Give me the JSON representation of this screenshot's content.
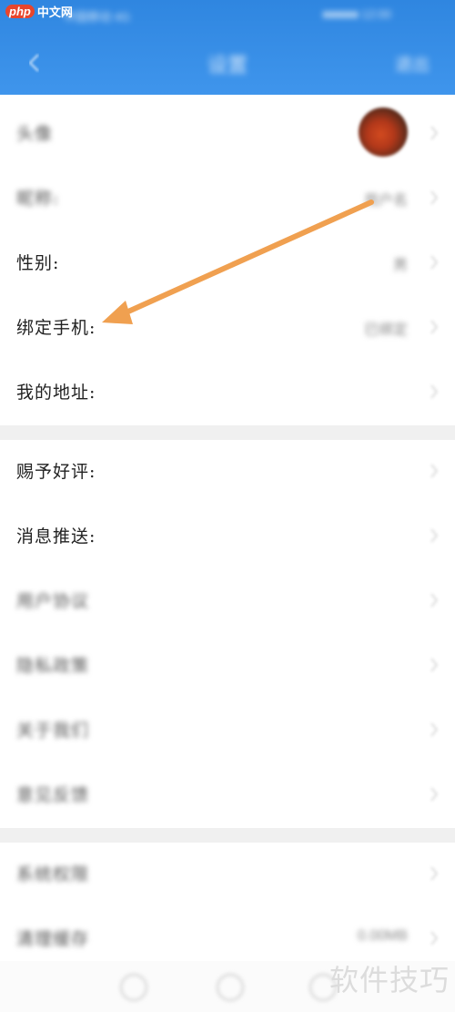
{
  "watermark": {
    "brand_prefix": "php",
    "brand_name": "中文网",
    "corner_text": "软件技巧"
  },
  "status_bar": {
    "left_text": "中国移动 4G",
    "right_text": "■■■■■ 12:00"
  },
  "header": {
    "title": "设置",
    "action": "退出"
  },
  "profile_section": [
    {
      "label": "头像",
      "blurred": true,
      "type": "avatar"
    },
    {
      "label": "昵称:",
      "blurred": true,
      "value": "用户名"
    },
    {
      "label": "性别:",
      "blurred": false,
      "value": "男"
    },
    {
      "label": "绑定手机:",
      "blurred": false,
      "value": "已绑定"
    },
    {
      "label": "我的地址:",
      "blurred": false,
      "value": ""
    }
  ],
  "more_section": [
    {
      "label": "赐予好评:",
      "blurred": false
    },
    {
      "label": "消息推送:",
      "blurred": false
    },
    {
      "label": "用户协议",
      "blurred": true
    },
    {
      "label": "隐私政策",
      "blurred": true
    },
    {
      "label": "关于我们",
      "blurred": true
    },
    {
      "label": "意见反馈",
      "blurred": true
    }
  ],
  "extra_section": [
    {
      "label": "系统权限",
      "blurred": true,
      "value": ""
    },
    {
      "label": "清理缓存",
      "blurred": true,
      "value": "0.00MB"
    }
  ],
  "colors": {
    "header_bg": "#3a8fe8",
    "arrow": "#f0a050",
    "divider": "#f0f0f0"
  }
}
